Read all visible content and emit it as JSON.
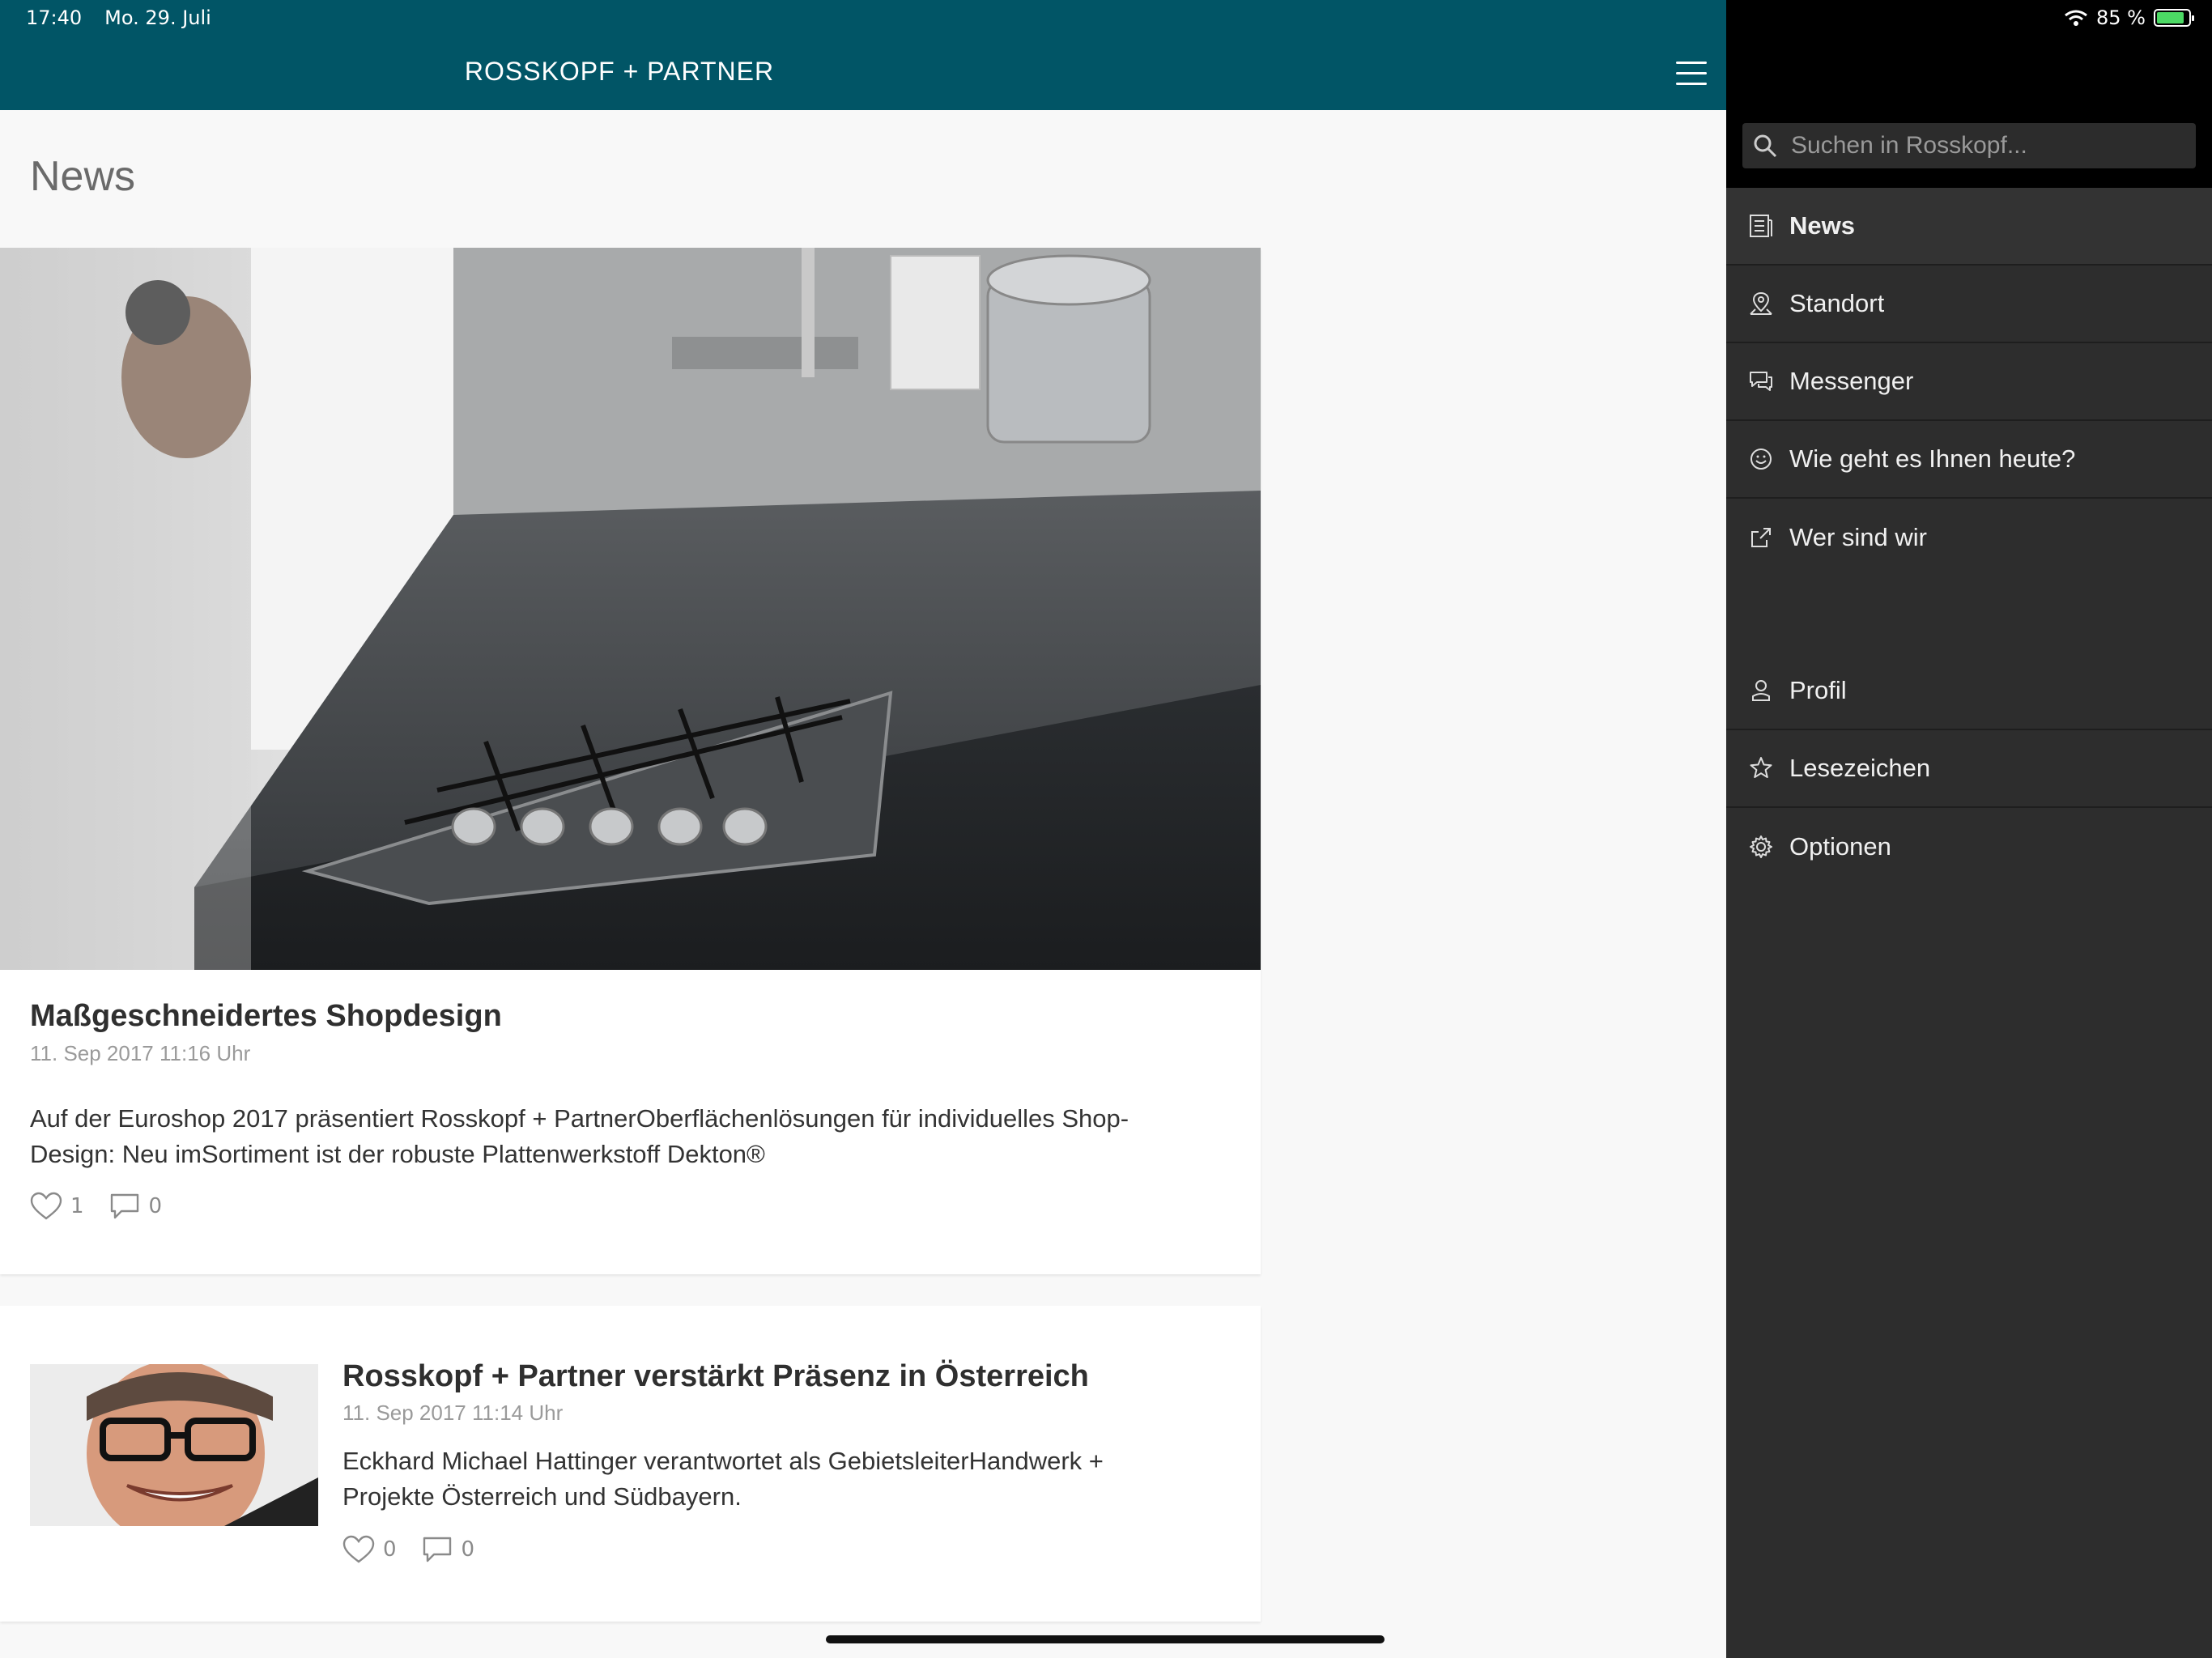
{
  "status": {
    "time": "17:40",
    "date": "Mo. 29. Juli",
    "battery": "85 %",
    "battery_level": 0.85
  },
  "header": {
    "title": "ROSSKOPF + PARTNER"
  },
  "page": {
    "title": "News"
  },
  "articles": [
    {
      "title": "Maßgeschneidertes Shopdesign",
      "date": "11. Sep 2017 11:16 Uhr",
      "text_line1": "Auf der Euroshop 2017 präsentiert Rosskopf + PartnerOberflächenlösungen für individuelles Shop-",
      "text_line2": "Design: Neu imSortiment ist der robuste Plattenwerkstoff Dekton®",
      "likes": "1",
      "comments": "0"
    },
    {
      "title": "Rosskopf + Partner verstärkt Präsenz in Österreich",
      "date": "11. Sep 2017 11:14 Uhr",
      "text_line1": "Eckhard Michael Hattinger verantwortet als GebietsleiterHandwerk +",
      "text_line2": "Projekte Österreich und Südbayern.",
      "likes": "0",
      "comments": "0"
    }
  ],
  "drawer": {
    "search_placeholder": "Suchen in Rosskopf...",
    "items": [
      {
        "label": "News",
        "icon": "news-icon",
        "active": true
      },
      {
        "label": "Standort",
        "icon": "location-icon"
      },
      {
        "label": "Messenger",
        "icon": "chat-icon"
      },
      {
        "label": "Wie geht es Ihnen heute?",
        "icon": "smiley-icon"
      },
      {
        "label": "Wer sind wir",
        "icon": "external-link-icon"
      },
      {
        "label": "Profil",
        "icon": "profile-icon"
      },
      {
        "label": "Lesezeichen",
        "icon": "star-icon"
      },
      {
        "label": "Optionen",
        "icon": "gear-icon"
      }
    ]
  },
  "colors": {
    "header": "#015566",
    "drawer": "#2d2d2d",
    "drawer_top": "#000000"
  }
}
